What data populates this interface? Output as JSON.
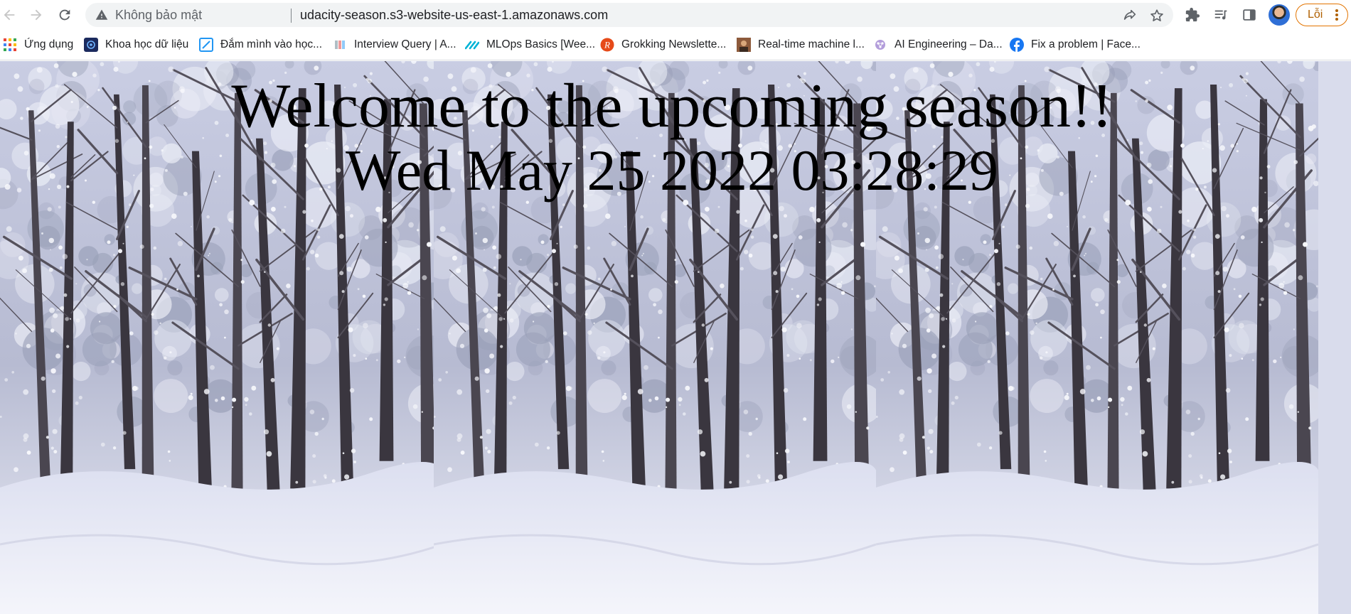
{
  "browser": {
    "security_label": "Không bảo mật",
    "url": "udacity-season.s3-website-us-east-1.amazonaws.com",
    "error_button_label": "Lỗi"
  },
  "bookmarks": [
    {
      "label": "Ứng dụng",
      "icon": "apps-grid-icon"
    },
    {
      "label": "Khoa học dữ liệu",
      "icon": "data-science-icon"
    },
    {
      "label": "Đắm mình vào học...",
      "icon": "d2l-icon"
    },
    {
      "label": "Interview Query | A...",
      "icon": "interview-query-icon"
    },
    {
      "label": "MLOps Basics [Wee...",
      "icon": "mlops-icon"
    },
    {
      "label": "Grokking Newslette...",
      "icon": "grokking-icon"
    },
    {
      "label": "Real-time machine l...",
      "icon": "realtime-ml-icon"
    },
    {
      "label": "AI Engineering – Da...",
      "icon": "ai-engineering-icon"
    },
    {
      "label": "Fix a problem | Face...",
      "icon": "facebook-icon"
    }
  ],
  "page": {
    "headline": "Welcome to the upcoming season!!",
    "datetime": "Wed May 25 2022 03:28:29"
  },
  "colors": {
    "omnibox_bg": "#f1f3f4",
    "error_accent": "#e37400",
    "facebook_blue": "#1877f2"
  }
}
